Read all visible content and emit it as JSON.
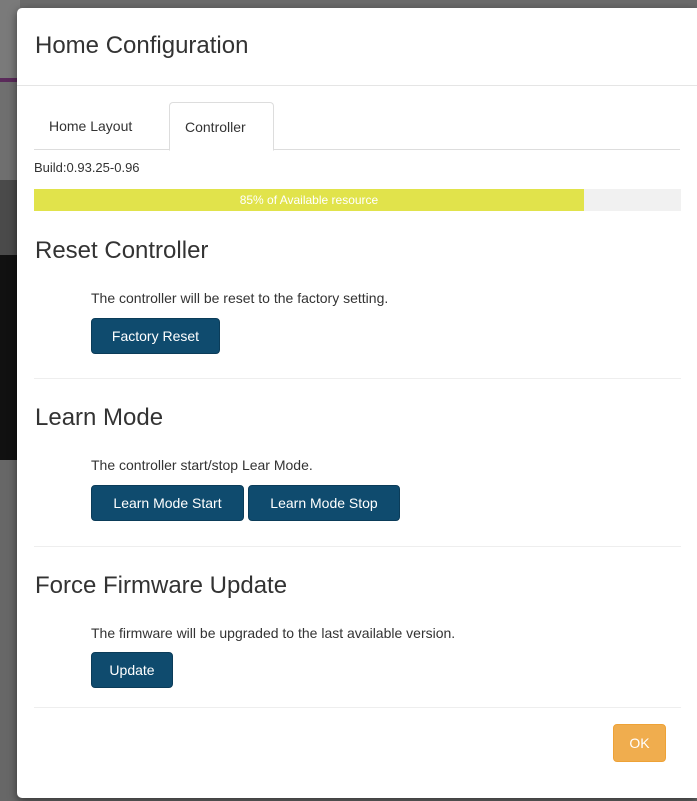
{
  "modal": {
    "title": "Home Configuration"
  },
  "tabs": [
    {
      "label": "Home Layout",
      "active": false
    },
    {
      "label": "Controller",
      "active": true
    }
  ],
  "build": {
    "text": "Build:0.93.25-0.96"
  },
  "resource": {
    "label": "85% of Available resource",
    "percent": 85,
    "color": "#e1e34b"
  },
  "sections": {
    "reset": {
      "title": "Reset Controller",
      "description": "The controller will be reset to the factory setting.",
      "button": "Factory Reset"
    },
    "learn": {
      "title": "Learn Mode",
      "description": "The controller start/stop Lear Mode.",
      "start_button": "Learn Mode Start",
      "stop_button": "Learn Mode Stop"
    },
    "firmware": {
      "title": "Force Firmware Update",
      "description": "The firmware will be upgraded to the last available version.",
      "button": "Update"
    }
  },
  "footer": {
    "ok_label": "OK"
  },
  "colors": {
    "primary_button": "#0f4b6e",
    "ok_button": "#f0ad4e",
    "progress_fill": "#e1e34b"
  }
}
